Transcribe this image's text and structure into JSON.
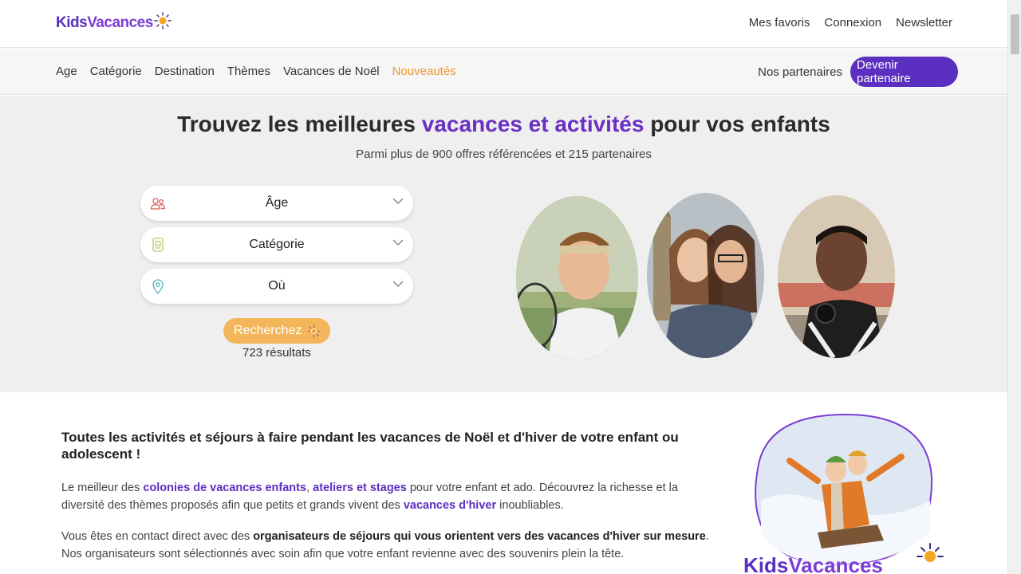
{
  "header": {
    "logo_kids": "Kids",
    "logo_vacances": "Vacances",
    "links": [
      "Mes favoris",
      "Connexion",
      "Newsletter"
    ]
  },
  "nav": {
    "items": [
      "Age",
      "Catégorie",
      "Destination",
      "Thèmes",
      "Vacances de Noël"
    ],
    "new_label": "Nouveautés",
    "partners_label": "Nos partenaires",
    "become_partner_label": "Devenir partenaire"
  },
  "hero": {
    "title_start": "Trouvez les meilleures ",
    "title_accent": "vacances et activités",
    "title_end": " pour vos enfants",
    "subtitle": "Parmi plus de 900 offres référencées et 215 partenaires",
    "filters": {
      "age": "Âge",
      "category": "Catégorie",
      "where": "Où"
    },
    "search_label": "Recherchez",
    "results_label": "723 résultats"
  },
  "content": {
    "title": "Toutes les activités et séjours à faire pendant les vacances de Noël et d'hiver de votre enfant ou adolescent !",
    "p1": {
      "t1": "Le meilleur des ",
      "link1": "colonies de vacances enfants",
      "t2": ", ",
      "link2": "ateliers et stages",
      "t3": "  pour  votre enfant et ado. Découvrez la richesse et la diversité des thèmes proposés afin que petits et grands vivent des ",
      "link3": "vacances d'hiver",
      "t4": " inoubliables."
    },
    "p2": {
      "t1": "Vous êtes en contact direct avec des ",
      "bold": "organisateurs de séjours qui vous orientent vers des vacances d'hiver sur mesure",
      "t2": ". Nos organisateurs sont sélectionnés avec soin afin que votre enfant revienne avec des souvenirs plein la tête."
    },
    "promo_logo_kids": "Kids",
    "promo_logo_vacances": "Vacances"
  },
  "colors": {
    "brand_purple": "#5b2fc0",
    "accent_orange": "#f0962a",
    "search_orange": "#f4b65a"
  }
}
